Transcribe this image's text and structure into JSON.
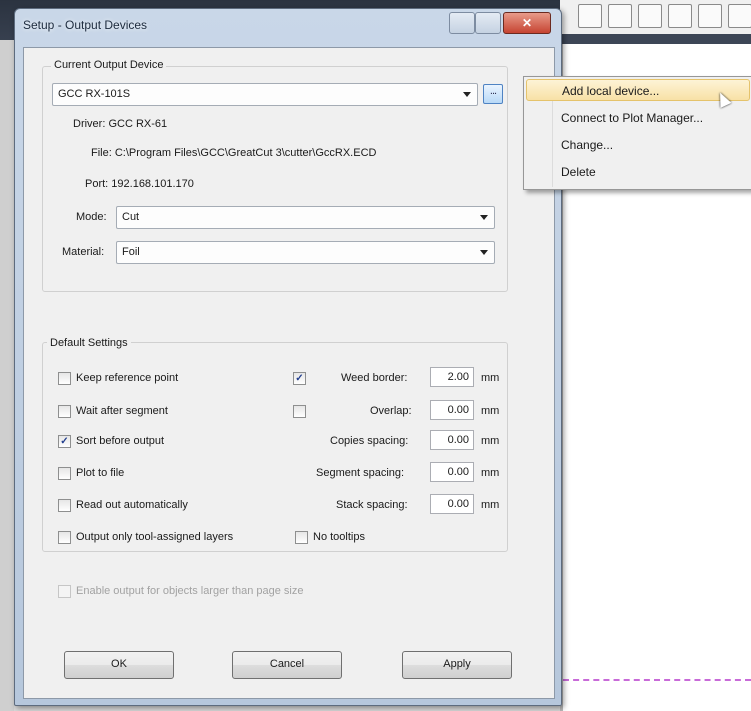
{
  "window": {
    "title": "Setup - Output Devices",
    "close_glyph": "✕"
  },
  "current_device": {
    "group_title": "Current Output Device",
    "device": "GCC RX-101S",
    "dots": "...",
    "driver": "Driver: GCC RX-61",
    "file": "File: C:\\Program Files\\GCC\\GreatCut 3\\cutter\\GccRX.ECD",
    "port": "Port: 192.168.101.170",
    "mode_label": "Mode:",
    "mode_value": "Cut",
    "material_label": "Material:",
    "material_value": "Foil"
  },
  "defaults": {
    "group_title": "Default Settings",
    "keep_reference_point": {
      "label": "Keep reference point",
      "checked": false
    },
    "wait_after_segment": {
      "label": "Wait after segment",
      "checked": false
    },
    "sort_before_output": {
      "label": "Sort before output",
      "checked": true
    },
    "plot_to_file": {
      "label": "Plot to file",
      "checked": false
    },
    "read_out_automatically": {
      "label": "Read out automatically",
      "checked": false
    },
    "output_only_tool_assigned": {
      "label": "Output only tool-assigned layers",
      "checked": false
    },
    "weed_border": {
      "checked": true,
      "label": "Weed border:",
      "value": "2.00",
      "unit": "mm"
    },
    "overlap": {
      "checked": false,
      "label": "Overlap:",
      "value": "0.00",
      "unit": "mm"
    },
    "copies_spacing": {
      "label": "Copies spacing:",
      "value": "0.00",
      "unit": "mm"
    },
    "segment_spacing": {
      "label": "Segment spacing:",
      "value": "0.00",
      "unit": "mm"
    },
    "stack_spacing": {
      "label": "Stack spacing:",
      "value": "0.00",
      "unit": "mm"
    },
    "no_tooltips": {
      "label": "No tooltips",
      "checked": false
    }
  },
  "enable_large": {
    "label": "Enable output for objects larger than page size",
    "checked": false,
    "disabled": true
  },
  "buttons": {
    "ok": "OK",
    "cancel": "Cancel",
    "apply": "Apply"
  },
  "context_menu": {
    "items": [
      "Add local device...",
      "Connect to Plot Manager...",
      "Change...",
      "Delete"
    ],
    "highlighted_index": 0
  }
}
